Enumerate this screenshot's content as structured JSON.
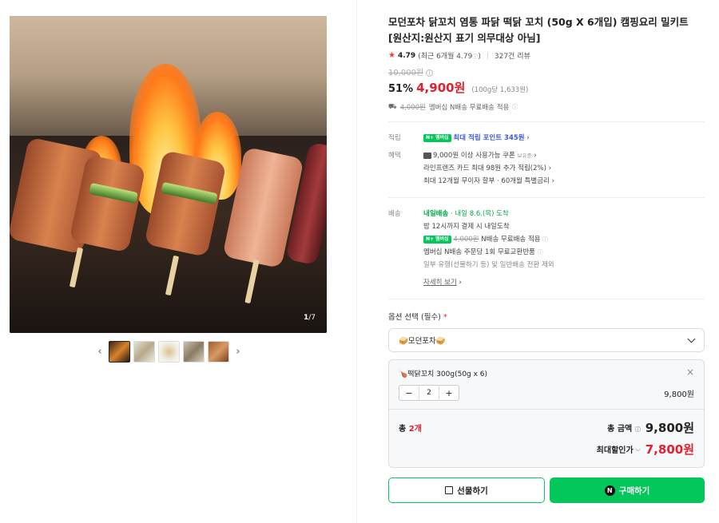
{
  "gallery": {
    "counter_current": "1",
    "counter_total": "/7",
    "prev_icon": "chevron-left-icon",
    "next_icon": "chevron-right-icon"
  },
  "product": {
    "title": "모던포차 닭꼬치 염통 파닭 떡닭 꼬치 (50g X 6개입) 캠핑요리 밀키트 [원산지:원산지 표기 의무대상 아님]",
    "rating": "4.79",
    "rating_recent": "(최근 6개월 4.79",
    "rating_recent_close": ")",
    "reviews": "327건 리뷰",
    "original_price": "10,000원",
    "discount": "51%",
    "price": "4,900원",
    "unit_price": "(100g당 1,633원)",
    "ship_strike": "4,000원",
    "ship_note": "멤버십 N배송 무료배송 적용"
  },
  "benefits": {
    "points_label": "적립",
    "npay_badge": "N+ 멤버십",
    "points_text": "최대 적립 포인트 345원",
    "benefit_label": "혜택",
    "coupon_text": "9,000원 이상 사용가능 쿠폰",
    "coupon_tag": "보유중",
    "card_text": "라인프렌즈 카드 최대 98원 추가 적립(2%)",
    "installment_text": "최대 12개월 무이자 할부 · 60개월 특별금리"
  },
  "shipping": {
    "label": "배송",
    "badge": "내일배송",
    "arrival": "· 내일 8.6.(목) 도착",
    "line1": "밤 12시까지 결제 시 내일도착",
    "npay_badge": "N+ 멤버십",
    "strike": "4,000원",
    "line2": "N배송 무료배송 적용",
    "line3": "멤버십 N배송 주문당 1회 무료교환반품",
    "line4": "일부 유형(선물하기 등) 및 일반배송 전환 제외",
    "more": "자세히 보기"
  },
  "options": {
    "title": "옵션 선택 (필수)",
    "required_mark": "*",
    "selected_value": "🥪모던포차🥪"
  },
  "selected_item": {
    "name": "🍗떡닭꼬치 300g(50g x 6)",
    "qty": "2",
    "subtotal": "9,800원"
  },
  "totals": {
    "count_prefix": "총 ",
    "count_value": "2개",
    "amount_label": "총 금액",
    "amount": "9,800원",
    "max_disc_label": "최대할인가",
    "max_disc": "7,800원"
  },
  "buttons": {
    "gift": "선물하기",
    "buy": "구매하기"
  },
  "colors": {
    "accent_green": "#03c75a",
    "price_red": "#e3202e",
    "points_blue": "#3e5bd9"
  }
}
